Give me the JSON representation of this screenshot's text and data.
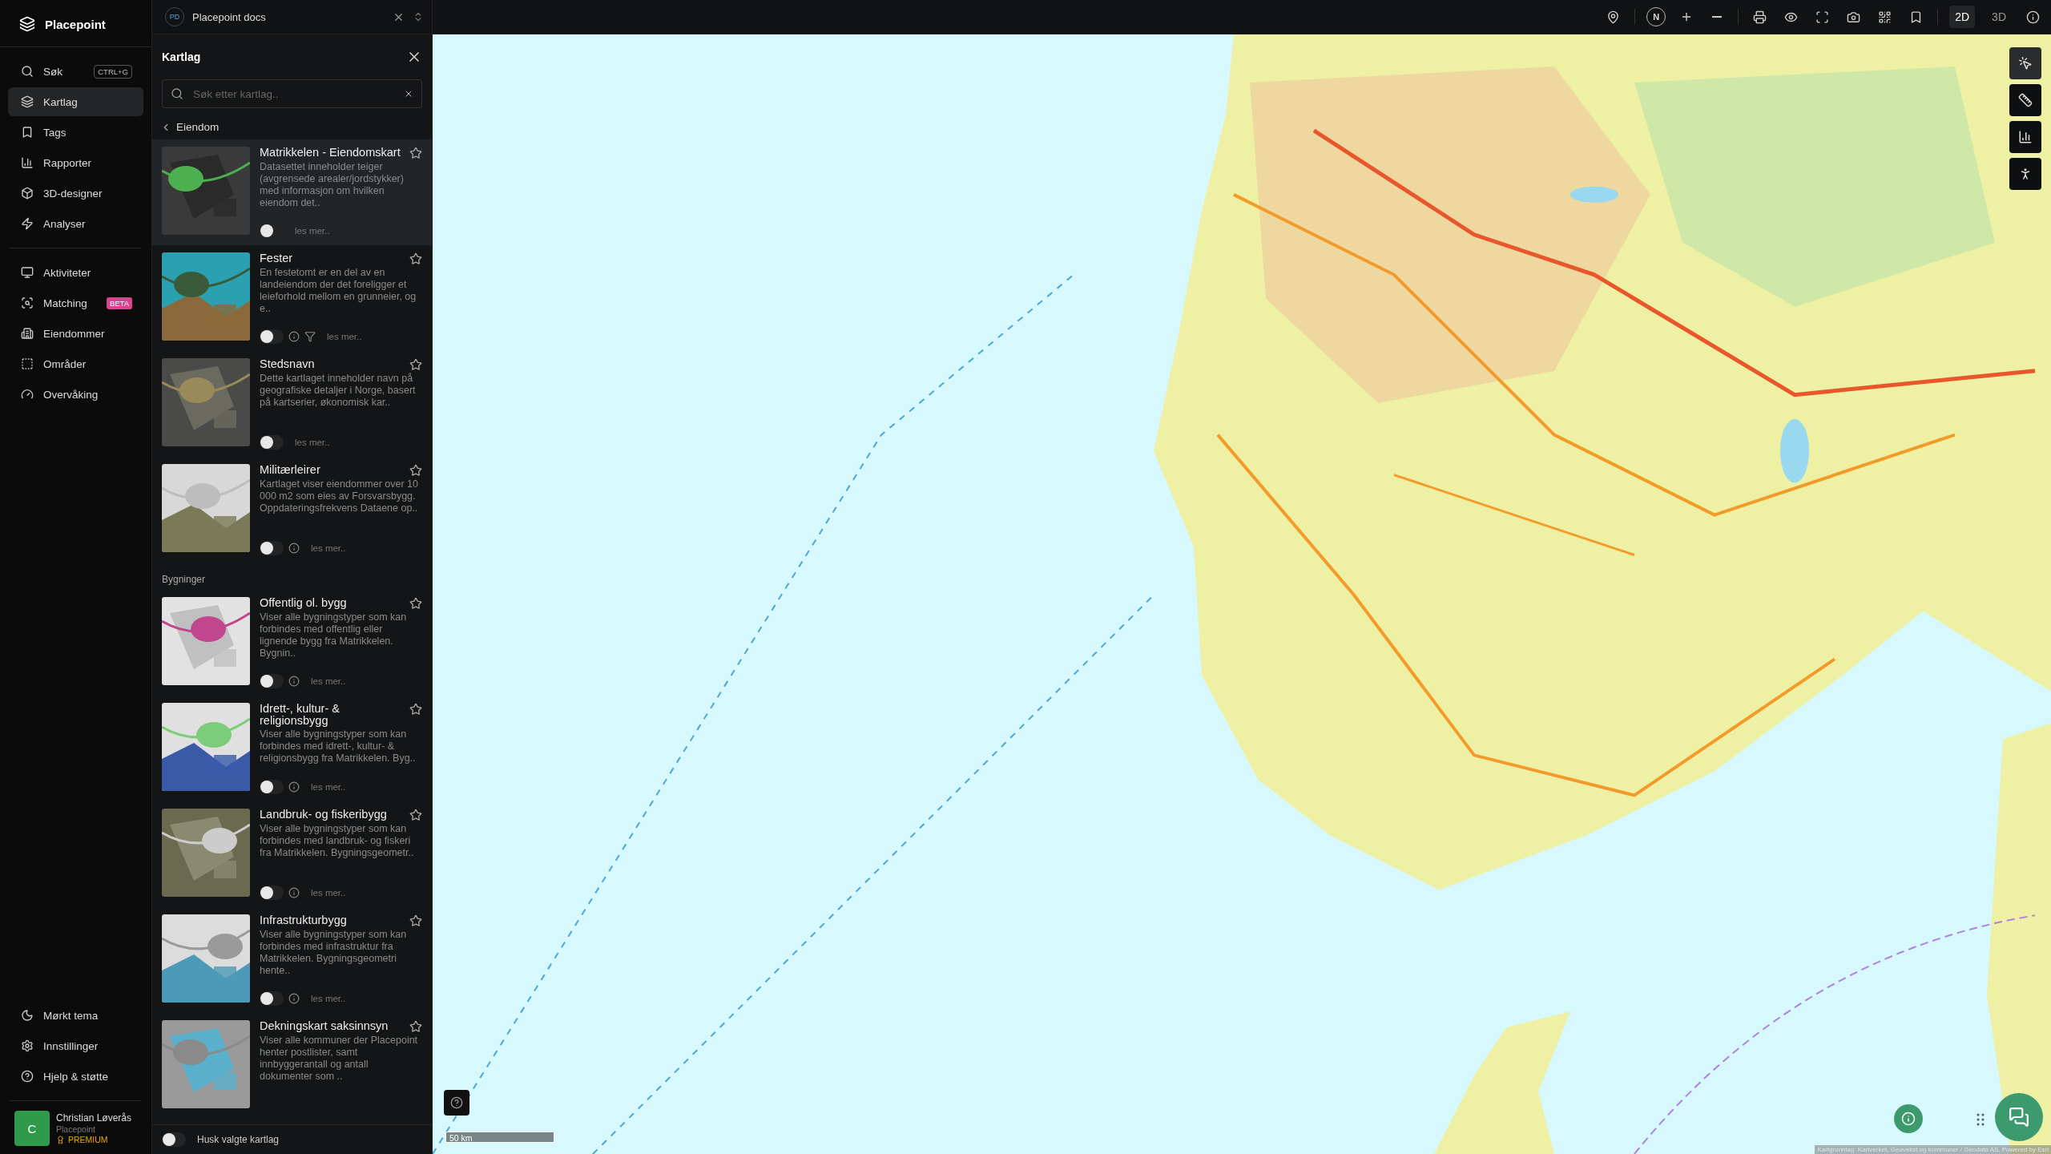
{
  "app": {
    "name": "Placepoint"
  },
  "nav": {
    "main": [
      {
        "label": "Søk",
        "shortcut": "CTRL+G",
        "selected": false
      },
      {
        "label": "Kartlag",
        "selected": true
      },
      {
        "label": "Tags",
        "selected": false
      },
      {
        "label": "Rapporter",
        "selected": false
      },
      {
        "label": "3D-designer",
        "selected": false
      },
      {
        "label": "Analyser",
        "selected": false
      }
    ],
    "secondary": [
      {
        "label": "Aktiviteter",
        "selected": false
      },
      {
        "label": "Matching",
        "badge": "BETA",
        "selected": false
      },
      {
        "label": "Eiendommer",
        "selected": false
      },
      {
        "label": "Områder",
        "selected": false
      },
      {
        "label": "Overvåking",
        "selected": false
      }
    ],
    "bottom": [
      {
        "label": "Mørkt tema"
      },
      {
        "label": "Innstillinger"
      },
      {
        "label": "Hjelp & støtte"
      }
    ]
  },
  "user": {
    "initial": "C",
    "name": "Christian Løverås",
    "org": "Placepoint",
    "plan": "PREMIUM"
  },
  "workspace": {
    "initials": "PD",
    "name": "Placepoint docs"
  },
  "panel": {
    "title": "Kartlag",
    "search": {
      "placeholder": "Søk etter kartlag.."
    },
    "breadcrumb": "Eiendom",
    "sections": [
      {
        "layers": [
          {
            "title": "Matrikkelen - Eiendomskart",
            "description": "Datasettet inneholder teiger (avgrensede arealer/jordstykker) med informasjon om hvilken eiendom det..",
            "on": false,
            "info": false,
            "filter": false,
            "more": "les mer..",
            "selected": true
          },
          {
            "title": "Fester",
            "description": "En festetomt er en del av en landeiendom der det foreligger et leieforhold mellom en grunneier, og e..",
            "on": false,
            "info": true,
            "filter": true,
            "more": "les mer..",
            "selected": false
          },
          {
            "title": "Stedsnavn",
            "description": "Dette kartlaget inneholder navn på geografiske detaljer i Norge, basert på kartserier, økonomisk kar..",
            "on": false,
            "info": false,
            "filter": false,
            "more": "les mer..",
            "selected": false
          },
          {
            "title": "Militærleirer",
            "description": "Kartlaget viser eiendommer over 10 000 m2 som eies av Forsvarsbygg. Oppdateringsfrekvens Dataene op..",
            "on": false,
            "info": true,
            "filter": false,
            "more": "les mer..",
            "selected": false
          }
        ]
      },
      {
        "heading": "Bygninger",
        "layers": [
          {
            "title": "Offentlig ol. bygg",
            "description": "Viser alle bygningstyper som kan forbindes med offentlig eller lignende bygg fra Matrikkelen. Bygnin..",
            "on": false,
            "info": true,
            "filter": false,
            "more": "les mer..",
            "selected": false
          },
          {
            "title": "Idrett-, kultur- & religionsbygg",
            "description": "Viser alle bygningstyper som kan forbindes med idrett-, kultur- & religionsbygg fra Matrikkelen. Byg..",
            "on": false,
            "info": true,
            "filter": false,
            "more": "les mer..",
            "selected": false
          },
          {
            "title": "Landbruk- og fiskeribygg",
            "description": "Viser alle bygningstyper som kan forbindes med landbruk- og fiskeri fra Matrikkelen. Bygningsgeometr..",
            "on": false,
            "info": true,
            "filter": false,
            "more": "les mer..",
            "selected": false
          },
          {
            "title": "Infrastrukturbygg",
            "description": "Viser alle bygningstyper som kan forbindes med infrastruktur fra Matrikkelen. Bygningsgeometri hente..",
            "on": false,
            "info": true,
            "filter": false,
            "more": "les mer..",
            "selected": false
          },
          {
            "title": "Dekningskart saksinnsyn",
            "description": "Viser alle kommuner der Placepoint henter postlister, samt innbyggerantall og antall dokumenter som ..",
            "selected": false
          }
        ]
      }
    ],
    "footer": {
      "label": "Husk valgte kartlag",
      "on": false
    }
  },
  "toolbar": {
    "compass": "N",
    "views": [
      {
        "label": "2D",
        "selected": true
      },
      {
        "label": "3D",
        "selected": false
      }
    ]
  },
  "map": {
    "kind": "picture",
    "scale": "50 km",
    "attribution": "Kartgrunnlag: Kartverket, Geovekst og kommuner / Geodata AS, Powered by Esri"
  }
}
